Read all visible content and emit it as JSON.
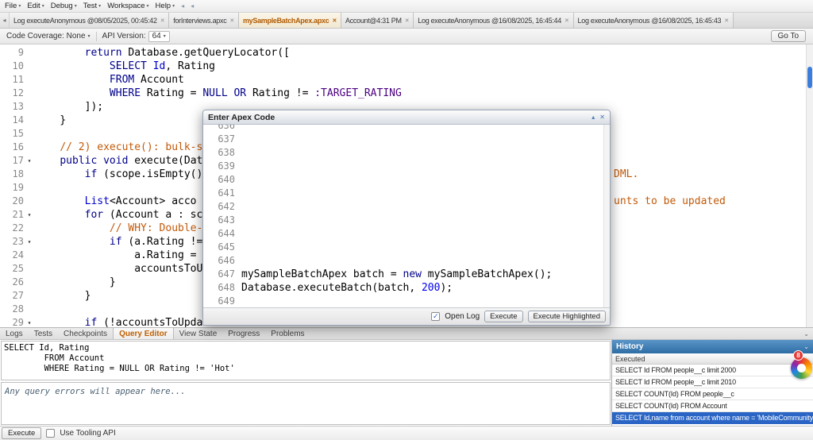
{
  "icons": {
    "caret_down": "▾",
    "close": "✕",
    "collapse": "▴",
    "chevron_down": "⌄",
    "scroll_left": "◂",
    "nav_back": "◂",
    "nav_forward": "◂",
    "fold": "▾",
    "check": "✓"
  },
  "menu_bar": {
    "items": [
      {
        "label": "File"
      },
      {
        "label": "Edit"
      },
      {
        "label": "Debug"
      },
      {
        "label": "Test"
      },
      {
        "label": "Workspace"
      },
      {
        "label": "Help"
      }
    ]
  },
  "tab_bar": {
    "tabs": [
      {
        "label": "Log executeAnonymous @08/05/2025, 00:45:42",
        "active": false
      },
      {
        "label": "forInterviews.apxc",
        "active": false
      },
      {
        "label": "mySampleBatchApex.apxc",
        "active": true
      },
      {
        "label": "Account@4:31 PM",
        "active": false
      },
      {
        "label": "Log executeAnonymous @16/08/2025, 16:45:44",
        "active": false
      },
      {
        "label": "Log executeAnonymous @16/08/2025, 16:45:43",
        "active": false
      }
    ]
  },
  "toolbar": {
    "code_coverage": "Code Coverage: None",
    "api_version_label": "API Version:",
    "api_version": "64",
    "go_to": "Go To"
  },
  "editor": {
    "lines": [
      {
        "num": "9",
        "tokens": [
          [
            "p",
            "        "
          ],
          [
            "k",
            "return"
          ],
          [
            "p",
            " Database.getQueryLocator(["
          ]
        ]
      },
      {
        "num": "10",
        "tokens": [
          [
            "p",
            "            "
          ],
          [
            "k",
            "SELECT"
          ],
          [
            "p",
            " "
          ],
          [
            "t",
            "Id"
          ],
          [
            "p",
            ", Rating"
          ]
        ]
      },
      {
        "num": "11",
        "tokens": [
          [
            "p",
            "            "
          ],
          [
            "k",
            "FROM"
          ],
          [
            "p",
            " Account"
          ]
        ]
      },
      {
        "num": "12",
        "tokens": [
          [
            "p",
            "            "
          ],
          [
            "k",
            "WHERE"
          ],
          [
            "p",
            " Rating = "
          ],
          [
            "k",
            "NULL"
          ],
          [
            "p",
            " "
          ],
          [
            "k",
            "OR"
          ],
          [
            "p",
            " Rating != "
          ],
          [
            "v",
            ":TARGET_RATING"
          ]
        ]
      },
      {
        "num": "13",
        "tokens": [
          [
            "p",
            "        ]);"
          ]
        ]
      },
      {
        "num": "14",
        "tokens": [
          [
            "p",
            "    }"
          ]
        ]
      },
      {
        "num": "15",
        "tokens": []
      },
      {
        "num": "16",
        "tokens": [
          [
            "p",
            "    "
          ],
          [
            "c",
            "// 2) execute(): bulk-s"
          ]
        ]
      },
      {
        "num": "17",
        "fold": true,
        "tokens": [
          [
            "p",
            "    "
          ],
          [
            "k",
            "public"
          ],
          [
            "p",
            " "
          ],
          [
            "k",
            "void"
          ],
          [
            "p",
            " execute(Dat"
          ]
        ]
      },
      {
        "num": "18",
        "tokens": [
          [
            "p",
            "        "
          ],
          [
            "k",
            "if"
          ],
          [
            "p",
            " (scope.isEmpty()"
          ]
        ],
        "right": "DML."
      },
      {
        "num": "19",
        "tokens": []
      },
      {
        "num": "20",
        "tokens": [
          [
            "p",
            "        "
          ],
          [
            "t",
            "List"
          ],
          [
            "p",
            "<Account> acco"
          ]
        ],
        "right": "unts to be updated"
      },
      {
        "num": "21",
        "fold": true,
        "tokens": [
          [
            "p",
            "        "
          ],
          [
            "k",
            "for"
          ],
          [
            "p",
            " (Account a : sc"
          ]
        ]
      },
      {
        "num": "22",
        "tokens": [
          [
            "p",
            "            "
          ],
          [
            "c",
            "// WHY: Double-"
          ]
        ]
      },
      {
        "num": "23",
        "fold": true,
        "tokens": [
          [
            "p",
            "            "
          ],
          [
            "k",
            "if"
          ],
          [
            "p",
            " (a.Rating !="
          ]
        ]
      },
      {
        "num": "24",
        "tokens": [
          [
            "p",
            "                a.Rating = "
          ]
        ]
      },
      {
        "num": "25",
        "tokens": [
          [
            "p",
            "                accountsToU"
          ]
        ]
      },
      {
        "num": "26",
        "tokens": [
          [
            "p",
            "            }"
          ]
        ]
      },
      {
        "num": "27",
        "tokens": [
          [
            "p",
            "        }"
          ]
        ]
      },
      {
        "num": "28",
        "tokens": []
      },
      {
        "num": "29",
        "fold": true,
        "tokens": [
          [
            "p",
            "        "
          ],
          [
            "k",
            "if"
          ],
          [
            "p",
            " (!accountsToUpda"
          ]
        ]
      }
    ]
  },
  "modal": {
    "title": "Enter Apex Code",
    "open_log": "Open Log",
    "execute": "Execute",
    "execute_highlighted": "Execute Highlighted",
    "lines": [
      {
        "num": "636",
        "tokens": []
      },
      {
        "num": "637",
        "tokens": []
      },
      {
        "num": "638",
        "tokens": []
      },
      {
        "num": "639",
        "tokens": []
      },
      {
        "num": "640",
        "tokens": []
      },
      {
        "num": "641",
        "tokens": []
      },
      {
        "num": "642",
        "tokens": []
      },
      {
        "num": "643",
        "tokens": []
      },
      {
        "num": "644",
        "tokens": []
      },
      {
        "num": "645",
        "tokens": []
      },
      {
        "num": "646",
        "tokens": []
      },
      {
        "num": "647",
        "tokens": [
          [
            "p",
            "mySampleBatchApex batch = "
          ],
          [
            "k",
            "new"
          ],
          [
            "p",
            " mySampleBatchApex();"
          ]
        ]
      },
      {
        "num": "648",
        "tokens": [
          [
            "p",
            "Database.executeBatch(batch, "
          ],
          [
            "n",
            "200"
          ],
          [
            "p",
            ");"
          ]
        ]
      },
      {
        "num": "649",
        "tokens": []
      }
    ]
  },
  "panel_tabs": {
    "tabs": [
      {
        "label": "Logs",
        "active": false
      },
      {
        "label": "Tests",
        "active": false
      },
      {
        "label": "Checkpoints",
        "active": false
      },
      {
        "label": "Query Editor",
        "active": true
      },
      {
        "label": "View State",
        "active": false
      },
      {
        "label": "Progress",
        "active": false
      },
      {
        "label": "Problems",
        "active": false
      }
    ]
  },
  "query_editor": {
    "query_lines": [
      "SELECT Id, Rating",
      "        FROM Account",
      "        WHERE Rating = NULL OR Rating != 'Hot'"
    ],
    "errors_placeholder": "Any query errors will appear here...",
    "execute": "Execute",
    "use_tooling_api": "Use Tooling API"
  },
  "history": {
    "title": "History",
    "section": "Executed",
    "rows": [
      {
        "text": "SELECT Id FROM people__c limit 2000",
        "selected": false
      },
      {
        "text": "SELECT Id FROM people__c limit 2010",
        "selected": false
      },
      {
        "text": "SELECT COUNT(Id) FROM people__c",
        "selected": false
      },
      {
        "text": "SELECT COUNT(Id) FROM Account",
        "selected": false
      },
      {
        "text": "SELECT Id,name from account where name = 'MobileCommunityIce",
        "selected": true
      }
    ]
  },
  "overlay": {
    "badge_count": "8"
  }
}
